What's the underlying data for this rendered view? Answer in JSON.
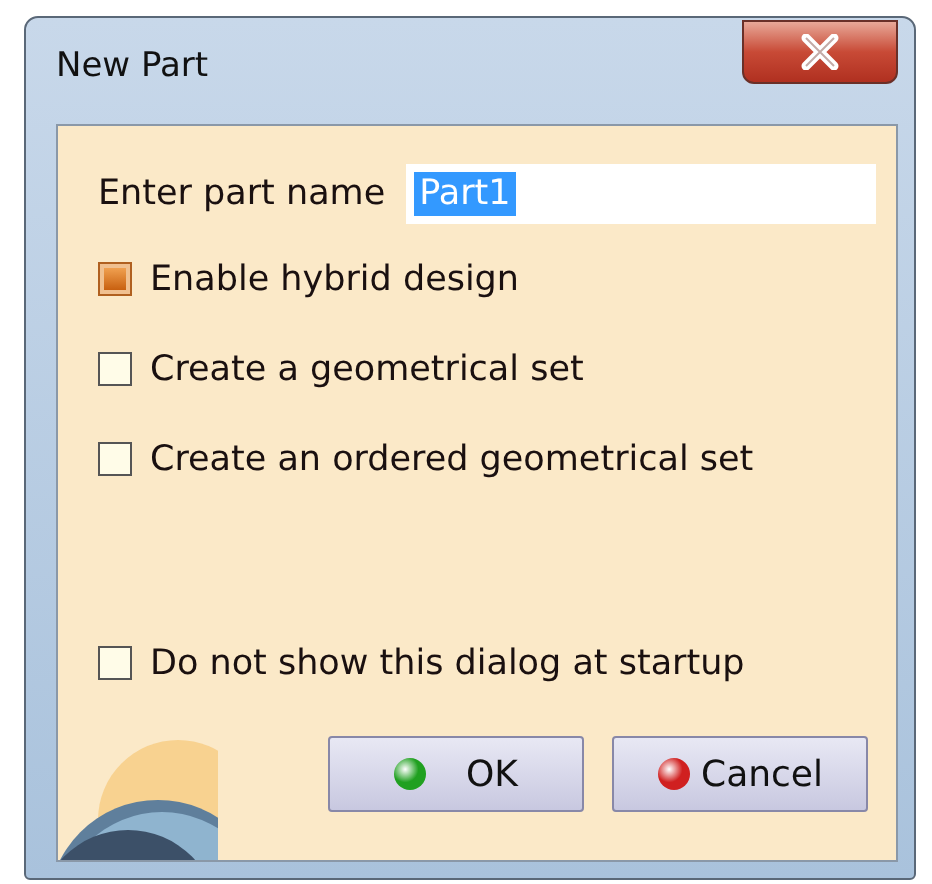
{
  "window": {
    "title": "New Part"
  },
  "name_field": {
    "label": "Enter part name",
    "value": "Part1",
    "text_selected": true
  },
  "options": [
    {
      "kind": "checkbox",
      "label": "Enable hybrid design",
      "checked": true
    },
    {
      "kind": "checkbox",
      "label": "Create a geometrical set",
      "checked": false
    },
    {
      "kind": "checkbox",
      "label": "Create an ordered geometrical set",
      "checked": false
    },
    {
      "kind": "spacer"
    },
    {
      "kind": "checkbox",
      "label": "Do not show this dialog at startup",
      "checked": false
    }
  ],
  "buttons": [
    {
      "label": "OK",
      "color": "#20a020"
    },
    {
      "label": "Cancel",
      "color": "#d02020"
    }
  ]
}
